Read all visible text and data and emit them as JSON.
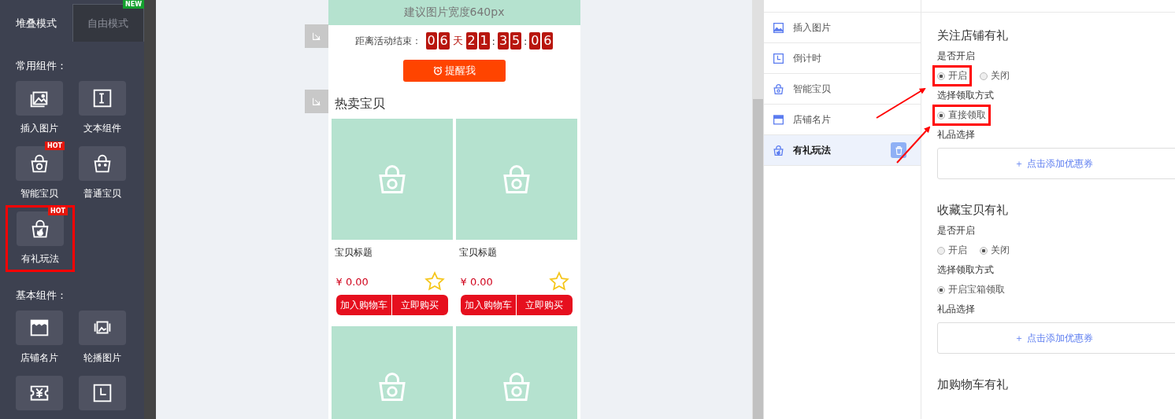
{
  "sidebar": {
    "tabs": [
      {
        "label": "堆叠模式",
        "selected": true
      },
      {
        "label": "自由模式",
        "selected": false,
        "badge": "NEW"
      }
    ],
    "groups": [
      {
        "title": "常用组件：",
        "items": [
          {
            "label": "插入图片",
            "kind": "image",
            "annotated": false
          },
          {
            "label": "文本组件",
            "kind": "text",
            "annotated": false
          },
          {
            "label": "智能宝贝",
            "kind": "smart",
            "badge": "HOT",
            "annotated": false
          },
          {
            "label": "普通宝贝",
            "kind": "basket",
            "annotated": false
          },
          {
            "label": "有礼玩法",
            "kind": "gift",
            "badge": "HOT",
            "annotated": true
          }
        ]
      },
      {
        "title": "基本组件：",
        "items": [
          {
            "label": "店铺名片",
            "kind": "banner",
            "annotated": false
          },
          {
            "label": "轮播图片",
            "kind": "carousel",
            "annotated": false
          },
          {
            "kind": "coupon",
            "annotated": false
          },
          {
            "kind": "clock",
            "annotated": false
          }
        ]
      }
    ]
  },
  "canvas": {
    "banner_hint": "建议图片宽度640px",
    "countdown": {
      "label": "距离活动结束：",
      "days": [
        "0",
        "6"
      ],
      "day_unit": "天",
      "hours": [
        "2",
        "1"
      ],
      "minutes": [
        "3",
        "5"
      ],
      "seconds": [
        "0",
        "6"
      ],
      "separator": ":"
    },
    "remind_button": "提醒我",
    "section_title": "热卖宝贝",
    "products": [
      {
        "kind": "full",
        "title": "宝贝标题",
        "price": "¥ 0.00",
        "cart_button": "加入购物车",
        "buy_button": "立即购买"
      },
      {
        "kind": "full",
        "title": "宝贝标题",
        "price": "¥ 0.00",
        "cart_button": "加入购物车",
        "buy_button": "立即购买"
      },
      {
        "kind": "image"
      },
      {
        "kind": "image"
      }
    ]
  },
  "component_list": {
    "items": [
      {
        "label": "插入图片",
        "kind": "image",
        "selected": false
      },
      {
        "label": "倒计时",
        "kind": "clock",
        "selected": false
      },
      {
        "label": "智能宝贝",
        "kind": "smart",
        "selected": false
      },
      {
        "label": "店铺名片",
        "kind": "banner",
        "selected": false
      },
      {
        "label": "有礼玩法",
        "kind": "gift",
        "selected": true
      }
    ]
  },
  "settings": {
    "sections": [
      {
        "title": "关注店铺有礼",
        "switch_label": "是否开启",
        "switch_options": [
          {
            "label": "开启",
            "selected": true,
            "annotated": true
          },
          {
            "label": "关闭",
            "selected": false,
            "annotated": false
          }
        ],
        "method_label": "选择领取方式",
        "method_options": [
          {
            "label": "直接领取",
            "selected": true,
            "annotated": true
          }
        ],
        "gift_label": "礼品选择",
        "add_button": "＋ 点击添加优惠券"
      },
      {
        "title": "收藏宝贝有礼",
        "switch_label": "是否开启",
        "switch_options": [
          {
            "label": "开启",
            "selected": false,
            "annotated": false
          },
          {
            "label": "关闭",
            "selected": true,
            "annotated": false
          }
        ],
        "method_label": "选择领取方式",
        "method_options": [
          {
            "label": "开启宝箱领取",
            "selected": true,
            "annotated": false
          }
        ],
        "gift_label": "礼品选择",
        "add_button": "＋ 点击添加优惠券"
      },
      {
        "title": "加购物车有礼"
      }
    ]
  }
}
